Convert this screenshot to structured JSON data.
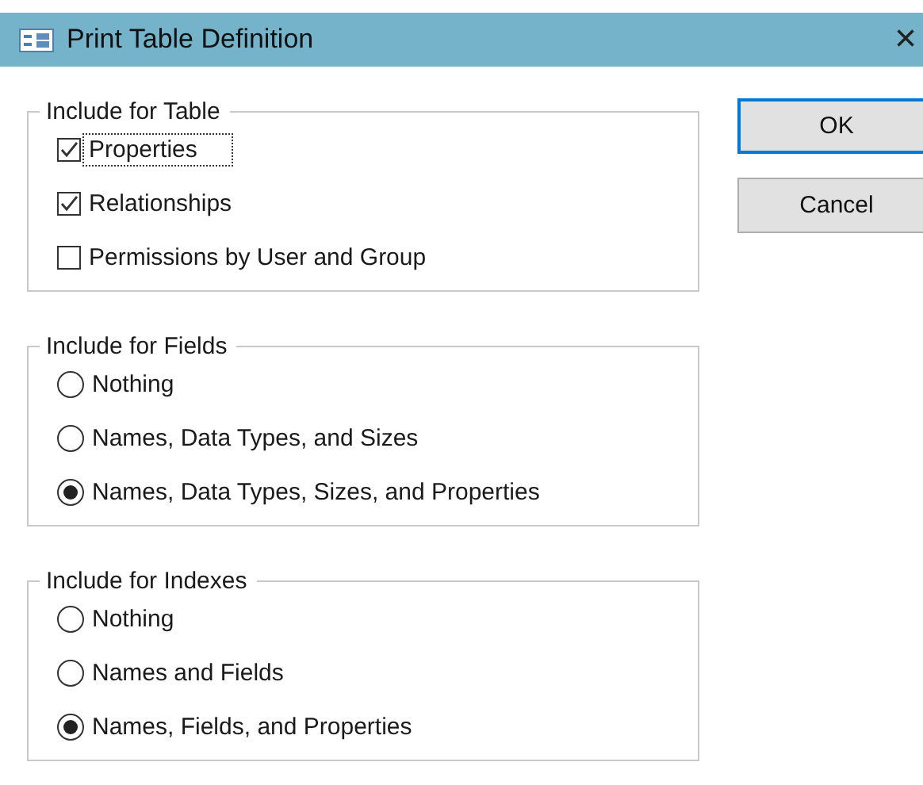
{
  "window": {
    "title": "Print Table Definition",
    "close": "×"
  },
  "groups": [
    {
      "title": "Include for Table",
      "options": [
        {
          "kind": "checkbox",
          "label": "Properties",
          "checked": true,
          "focused": true
        },
        {
          "kind": "checkbox",
          "label": "Relationships",
          "checked": true,
          "focused": false
        },
        {
          "kind": "checkbox",
          "label": "Permissions by User and Group",
          "checked": false,
          "focused": false
        }
      ]
    },
    {
      "title": "Include for Fields",
      "options": [
        {
          "kind": "radio",
          "label": "Nothing",
          "selected": false
        },
        {
          "kind": "radio",
          "label": "Names, Data Types, and Sizes",
          "selected": false
        },
        {
          "kind": "radio",
          "label": "Names, Data Types, Sizes, and Properties",
          "selected": true
        }
      ]
    },
    {
      "title": "Include for Indexes",
      "options": [
        {
          "kind": "radio",
          "label": "Nothing",
          "selected": false
        },
        {
          "kind": "radio",
          "label": "Names and Fields",
          "selected": false
        },
        {
          "kind": "radio",
          "label": "Names, Fields, and Properties",
          "selected": true
        }
      ]
    }
  ],
  "buttons": [
    {
      "label": "OK",
      "default": true
    },
    {
      "label": "Cancel",
      "default": false
    }
  ]
}
